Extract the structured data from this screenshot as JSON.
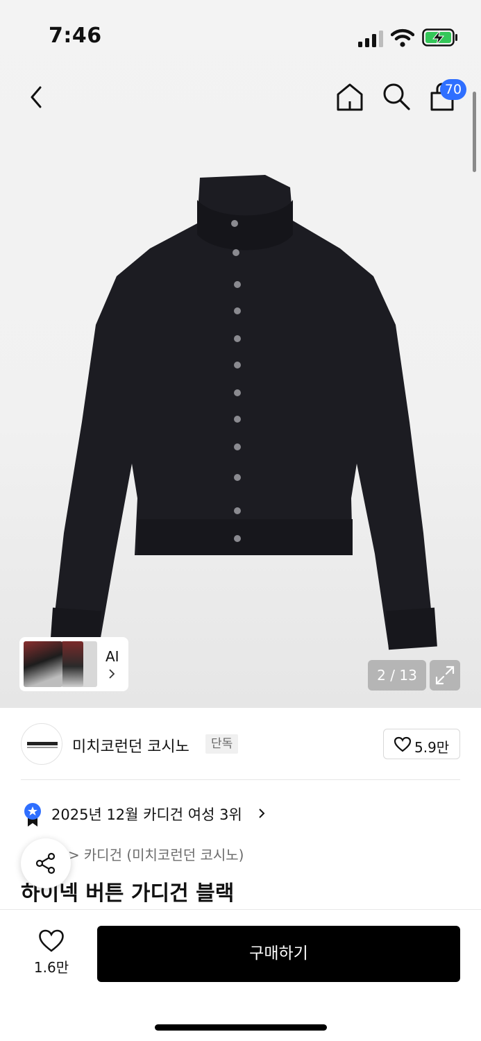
{
  "status_bar": {
    "time": "7:46",
    "battery": "charging"
  },
  "nav": {
    "cart_count": "70",
    "icons": [
      "back-icon",
      "home-icon",
      "search-icon",
      "shopping-bag-icon"
    ]
  },
  "gallery": {
    "counter": "2 / 13",
    "ai_label": "AI"
  },
  "brand": {
    "name": "미치코런던 코시노",
    "tag": "단독",
    "likes": "5.9만"
  },
  "ranking": {
    "text": "2025년 12월 카디건 여성 3위"
  },
  "breadcrumb": {
    "category": "카디건 (미치코런던 코시노)"
  },
  "product": {
    "title": "하이넥 버튼 가디건 블랙"
  },
  "bottom": {
    "wish_count": "1.6만",
    "buy_label": "구매하기"
  },
  "colors": {
    "accent": "#2f6fff",
    "buy_button": "#000000"
  }
}
